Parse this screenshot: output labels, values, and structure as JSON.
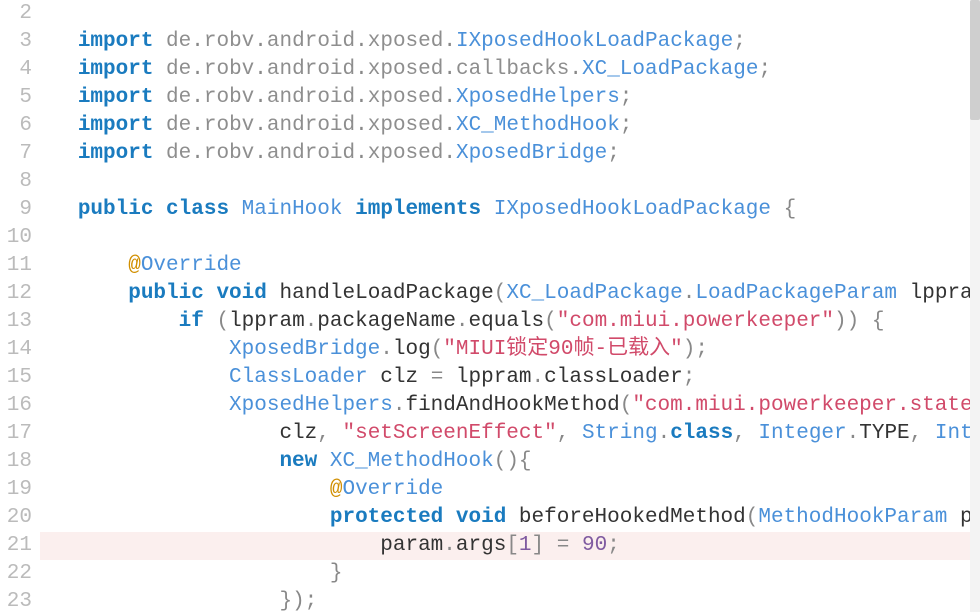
{
  "line_numbers": [
    "2",
    "3",
    "4",
    "5",
    "6",
    "7",
    "8",
    "9",
    "10",
    "11",
    "12",
    "13",
    "14",
    "15",
    "16",
    "17",
    "18",
    "19",
    "20",
    "21",
    "22",
    "23"
  ],
  "highlight_line": 21,
  "lines": [
    {
      "n": 2,
      "indent": "",
      "tokens": []
    },
    {
      "n": 3,
      "indent": "",
      "tokens": [
        {
          "t": "import",
          "c": "tok-kw"
        },
        {
          "t": " ",
          "c": ""
        },
        {
          "t": "de",
          "c": "tok-pkg"
        },
        {
          "t": ".",
          "c": "tok-punc"
        },
        {
          "t": "robv",
          "c": "tok-pkg"
        },
        {
          "t": ".",
          "c": "tok-punc"
        },
        {
          "t": "android",
          "c": "tok-pkg"
        },
        {
          "t": ".",
          "c": "tok-punc"
        },
        {
          "t": "xposed",
          "c": "tok-pkg"
        },
        {
          "t": ".",
          "c": "tok-punc"
        },
        {
          "t": "IXposedHookLoadPackage",
          "c": "tok-type"
        },
        {
          "t": ";",
          "c": "tok-punc"
        }
      ]
    },
    {
      "n": 4,
      "indent": "",
      "tokens": [
        {
          "t": "import",
          "c": "tok-kw"
        },
        {
          "t": " ",
          "c": ""
        },
        {
          "t": "de",
          "c": "tok-pkg"
        },
        {
          "t": ".",
          "c": "tok-punc"
        },
        {
          "t": "robv",
          "c": "tok-pkg"
        },
        {
          "t": ".",
          "c": "tok-punc"
        },
        {
          "t": "android",
          "c": "tok-pkg"
        },
        {
          "t": ".",
          "c": "tok-punc"
        },
        {
          "t": "xposed",
          "c": "tok-pkg"
        },
        {
          "t": ".",
          "c": "tok-punc"
        },
        {
          "t": "callbacks",
          "c": "tok-pkg"
        },
        {
          "t": ".",
          "c": "tok-punc"
        },
        {
          "t": "XC_LoadPackage",
          "c": "tok-type"
        },
        {
          "t": ";",
          "c": "tok-punc"
        }
      ]
    },
    {
      "n": 5,
      "indent": "",
      "tokens": [
        {
          "t": "import",
          "c": "tok-kw"
        },
        {
          "t": " ",
          "c": ""
        },
        {
          "t": "de",
          "c": "tok-pkg"
        },
        {
          "t": ".",
          "c": "tok-punc"
        },
        {
          "t": "robv",
          "c": "tok-pkg"
        },
        {
          "t": ".",
          "c": "tok-punc"
        },
        {
          "t": "android",
          "c": "tok-pkg"
        },
        {
          "t": ".",
          "c": "tok-punc"
        },
        {
          "t": "xposed",
          "c": "tok-pkg"
        },
        {
          "t": ".",
          "c": "tok-punc"
        },
        {
          "t": "XposedHelpers",
          "c": "tok-type"
        },
        {
          "t": ";",
          "c": "tok-punc"
        }
      ]
    },
    {
      "n": 6,
      "indent": "",
      "tokens": [
        {
          "t": "import",
          "c": "tok-kw"
        },
        {
          "t": " ",
          "c": ""
        },
        {
          "t": "de",
          "c": "tok-pkg"
        },
        {
          "t": ".",
          "c": "tok-punc"
        },
        {
          "t": "robv",
          "c": "tok-pkg"
        },
        {
          "t": ".",
          "c": "tok-punc"
        },
        {
          "t": "android",
          "c": "tok-pkg"
        },
        {
          "t": ".",
          "c": "tok-punc"
        },
        {
          "t": "xposed",
          "c": "tok-pkg"
        },
        {
          "t": ".",
          "c": "tok-punc"
        },
        {
          "t": "XC_MethodHook",
          "c": "tok-type"
        },
        {
          "t": ";",
          "c": "tok-punc"
        }
      ]
    },
    {
      "n": 7,
      "indent": "",
      "tokens": [
        {
          "t": "import",
          "c": "tok-kw"
        },
        {
          "t": " ",
          "c": ""
        },
        {
          "t": "de",
          "c": "tok-pkg"
        },
        {
          "t": ".",
          "c": "tok-punc"
        },
        {
          "t": "robv",
          "c": "tok-pkg"
        },
        {
          "t": ".",
          "c": "tok-punc"
        },
        {
          "t": "android",
          "c": "tok-pkg"
        },
        {
          "t": ".",
          "c": "tok-punc"
        },
        {
          "t": "xposed",
          "c": "tok-pkg"
        },
        {
          "t": ".",
          "c": "tok-punc"
        },
        {
          "t": "XposedBridge",
          "c": "tok-type"
        },
        {
          "t": ";",
          "c": "tok-punc"
        }
      ]
    },
    {
      "n": 8,
      "indent": "",
      "tokens": []
    },
    {
      "n": 9,
      "indent": "",
      "tokens": [
        {
          "t": "public",
          "c": "tok-kw"
        },
        {
          "t": " ",
          "c": ""
        },
        {
          "t": "class",
          "c": "tok-kw"
        },
        {
          "t": " ",
          "c": ""
        },
        {
          "t": "MainHook",
          "c": "tok-type"
        },
        {
          "t": " ",
          "c": ""
        },
        {
          "t": "implements",
          "c": "tok-kw"
        },
        {
          "t": " ",
          "c": ""
        },
        {
          "t": "IXposedHookLoadPackage",
          "c": "tok-type"
        },
        {
          "t": " ",
          "c": ""
        },
        {
          "t": "{",
          "c": "tok-punc"
        }
      ]
    },
    {
      "n": 10,
      "indent": "",
      "tokens": []
    },
    {
      "n": 11,
      "indent": "    ",
      "tokens": [
        {
          "t": "@",
          "c": "tok-ann"
        },
        {
          "t": "Override",
          "c": "tok-type"
        }
      ]
    },
    {
      "n": 12,
      "indent": "    ",
      "tokens": [
        {
          "t": "public",
          "c": "tok-kw"
        },
        {
          "t": " ",
          "c": ""
        },
        {
          "t": "void",
          "c": "tok-kw"
        },
        {
          "t": " ",
          "c": ""
        },
        {
          "t": "handleLoadPackage",
          "c": "tok-id"
        },
        {
          "t": "(",
          "c": "tok-punc"
        },
        {
          "t": "XC_LoadPackage",
          "c": "tok-type"
        },
        {
          "t": ".",
          "c": "tok-punc"
        },
        {
          "t": "LoadPackageParam",
          "c": "tok-type"
        },
        {
          "t": " ",
          "c": ""
        },
        {
          "t": "lppram",
          "c": "tok-id"
        }
      ]
    },
    {
      "n": 13,
      "indent": "        ",
      "tokens": [
        {
          "t": "if",
          "c": "tok-kw"
        },
        {
          "t": " ",
          "c": ""
        },
        {
          "t": "(",
          "c": "tok-punc"
        },
        {
          "t": "lppram",
          "c": "tok-id"
        },
        {
          "t": ".",
          "c": "tok-punc"
        },
        {
          "t": "packageName",
          "c": "tok-id"
        },
        {
          "t": ".",
          "c": "tok-punc"
        },
        {
          "t": "equals",
          "c": "tok-id"
        },
        {
          "t": "(",
          "c": "tok-punc"
        },
        {
          "t": "\"com.miui.powerkeeper\"",
          "c": "tok-str"
        },
        {
          "t": ")",
          "c": "tok-punc"
        },
        {
          "t": ")",
          "c": "tok-punc"
        },
        {
          "t": " ",
          "c": ""
        },
        {
          "t": "{",
          "c": "tok-punc"
        }
      ]
    },
    {
      "n": 14,
      "indent": "            ",
      "tokens": [
        {
          "t": "XposedBridge",
          "c": "tok-type"
        },
        {
          "t": ".",
          "c": "tok-punc"
        },
        {
          "t": "log",
          "c": "tok-id"
        },
        {
          "t": "(",
          "c": "tok-punc"
        },
        {
          "t": "\"MIUI锁定90帧-已载入\"",
          "c": "tok-str"
        },
        {
          "t": ")",
          "c": "tok-punc"
        },
        {
          "t": ";",
          "c": "tok-punc"
        }
      ]
    },
    {
      "n": 15,
      "indent": "            ",
      "tokens": [
        {
          "t": "ClassLoader",
          "c": "tok-type"
        },
        {
          "t": " ",
          "c": ""
        },
        {
          "t": "clz",
          "c": "tok-id"
        },
        {
          "t": " ",
          "c": ""
        },
        {
          "t": "=",
          "c": "tok-op"
        },
        {
          "t": " ",
          "c": ""
        },
        {
          "t": "lppram",
          "c": "tok-id"
        },
        {
          "t": ".",
          "c": "tok-punc"
        },
        {
          "t": "classLoader",
          "c": "tok-id"
        },
        {
          "t": ";",
          "c": "tok-punc"
        }
      ]
    },
    {
      "n": 16,
      "indent": "            ",
      "tokens": [
        {
          "t": "XposedHelpers",
          "c": "tok-type"
        },
        {
          "t": ".",
          "c": "tok-punc"
        },
        {
          "t": "findAndHookMethod",
          "c": "tok-id"
        },
        {
          "t": "(",
          "c": "tok-punc"
        },
        {
          "t": "\"com.miui.powerkeeper.statem",
          "c": "tok-str"
        }
      ]
    },
    {
      "n": 17,
      "indent": "                ",
      "tokens": [
        {
          "t": "clz",
          "c": "tok-id"
        },
        {
          "t": ",",
          "c": "tok-punc"
        },
        {
          "t": " ",
          "c": ""
        },
        {
          "t": "\"setScreenEffect\"",
          "c": "tok-str"
        },
        {
          "t": ",",
          "c": "tok-punc"
        },
        {
          "t": " ",
          "c": ""
        },
        {
          "t": "String",
          "c": "tok-type"
        },
        {
          "t": ".",
          "c": "tok-punc"
        },
        {
          "t": "class",
          "c": "tok-kw"
        },
        {
          "t": ",",
          "c": "tok-punc"
        },
        {
          "t": " ",
          "c": ""
        },
        {
          "t": "Integer",
          "c": "tok-type"
        },
        {
          "t": ".",
          "c": "tok-punc"
        },
        {
          "t": "TYPE",
          "c": "tok-id"
        },
        {
          "t": ",",
          "c": "tok-punc"
        },
        {
          "t": " ",
          "c": ""
        },
        {
          "t": "Inte",
          "c": "tok-type"
        }
      ]
    },
    {
      "n": 18,
      "indent": "                ",
      "tokens": [
        {
          "t": "new",
          "c": "tok-kw"
        },
        {
          "t": " ",
          "c": ""
        },
        {
          "t": "XC_MethodHook",
          "c": "tok-type"
        },
        {
          "t": "(",
          "c": "tok-punc"
        },
        {
          "t": ")",
          "c": "tok-punc"
        },
        {
          "t": "{",
          "c": "tok-punc"
        }
      ]
    },
    {
      "n": 19,
      "indent": "                    ",
      "tokens": [
        {
          "t": "@",
          "c": "tok-ann"
        },
        {
          "t": "Override",
          "c": "tok-type"
        }
      ]
    },
    {
      "n": 20,
      "indent": "                    ",
      "tokens": [
        {
          "t": "protected",
          "c": "tok-kw"
        },
        {
          "t": " ",
          "c": ""
        },
        {
          "t": "void",
          "c": "tok-kw"
        },
        {
          "t": " ",
          "c": ""
        },
        {
          "t": "beforeHookedMethod",
          "c": "tok-id"
        },
        {
          "t": "(",
          "c": "tok-punc"
        },
        {
          "t": "MethodHookParam",
          "c": "tok-type"
        },
        {
          "t": " ",
          "c": ""
        },
        {
          "t": "pa",
          "c": "tok-id"
        }
      ]
    },
    {
      "n": 21,
      "indent": "                        ",
      "tokens": [
        {
          "t": "param",
          "c": "tok-id"
        },
        {
          "t": ".",
          "c": "tok-punc"
        },
        {
          "t": "args",
          "c": "tok-id"
        },
        {
          "t": "[",
          "c": "tok-punc"
        },
        {
          "t": "1",
          "c": "tok-num"
        },
        {
          "t": "]",
          "c": "tok-punc"
        },
        {
          "t": " ",
          "c": ""
        },
        {
          "t": "=",
          "c": "tok-op"
        },
        {
          "t": " ",
          "c": ""
        },
        {
          "t": "90",
          "c": "tok-num"
        },
        {
          "t": ";",
          "c": "tok-punc"
        }
      ]
    },
    {
      "n": 22,
      "indent": "                    ",
      "tokens": [
        {
          "t": "}",
          "c": "tok-punc"
        }
      ]
    },
    {
      "n": 23,
      "indent": "                ",
      "tokens": [
        {
          "t": "}",
          "c": "tok-punc"
        },
        {
          "t": ")",
          "c": "tok-punc"
        },
        {
          "t": ";",
          "c": "tok-punc"
        }
      ]
    }
  ]
}
